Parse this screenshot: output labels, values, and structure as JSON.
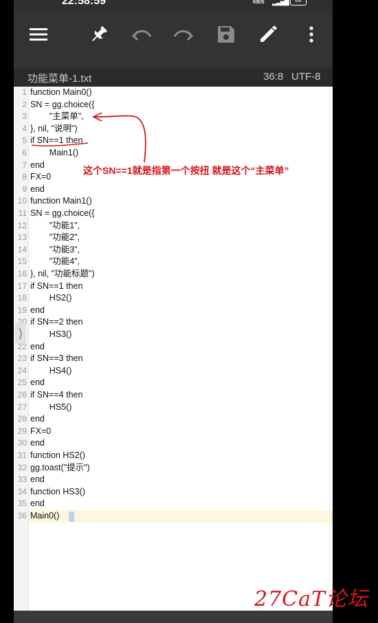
{
  "status_bar": {
    "time": "22:58:59",
    "net_unit": "KB/S",
    "battery": "84"
  },
  "toolbar": {
    "menu_icon": "hamburger-menu-icon",
    "pin_icon": "pin-icon",
    "undo_icon": "undo-icon",
    "redo_icon": "redo-icon",
    "save_icon": "save-icon",
    "edit_icon": "pencil-icon",
    "more_icon": "more-vertical-icon"
  },
  "file": {
    "name": "功能菜单-1.txt",
    "cursor": "36:8",
    "encoding": "UTF-8"
  },
  "editor": {
    "lines": [
      "function Main0()",
      "SN = gg.choice({",
      "        \"主菜单\",",
      "}, nil, \"说明\")",
      "if SN==1 then",
      "        Main1()",
      "end",
      "FX=0",
      "end",
      "function Main1()",
      "SN = gg.choice({",
      "        \"功能1\",",
      "        \"功能2\",",
      "        \"功能3\",",
      "        \"功能4\",",
      "}, nil, \"功能标题\")",
      "if SN==1 then",
      "        HS2()",
      "end",
      "if SN==2 then",
      "        HS3()",
      "end",
      "if SN==3 then",
      "        HS4()",
      "end",
      "if SN==4 then",
      "        HS5()",
      "end",
      "FX=0",
      "end",
      "function HS2()",
      "gg.toast(\"提示\")",
      "end",
      "function HS3()",
      "end",
      "Main0()"
    ],
    "current_line": 36
  },
  "annotation": {
    "text": "这个SN==1就是指第一个按扭 就是这个“主菜单”",
    "color": "#d6141c"
  },
  "watermark": {
    "text": "27CaT论坛"
  },
  "colors": {
    "toolbar_bg": "#333333",
    "fileinfo_bg": "#2b2b2b",
    "current_line_bg": "#fdf7df",
    "annotation": "#d6141c"
  }
}
